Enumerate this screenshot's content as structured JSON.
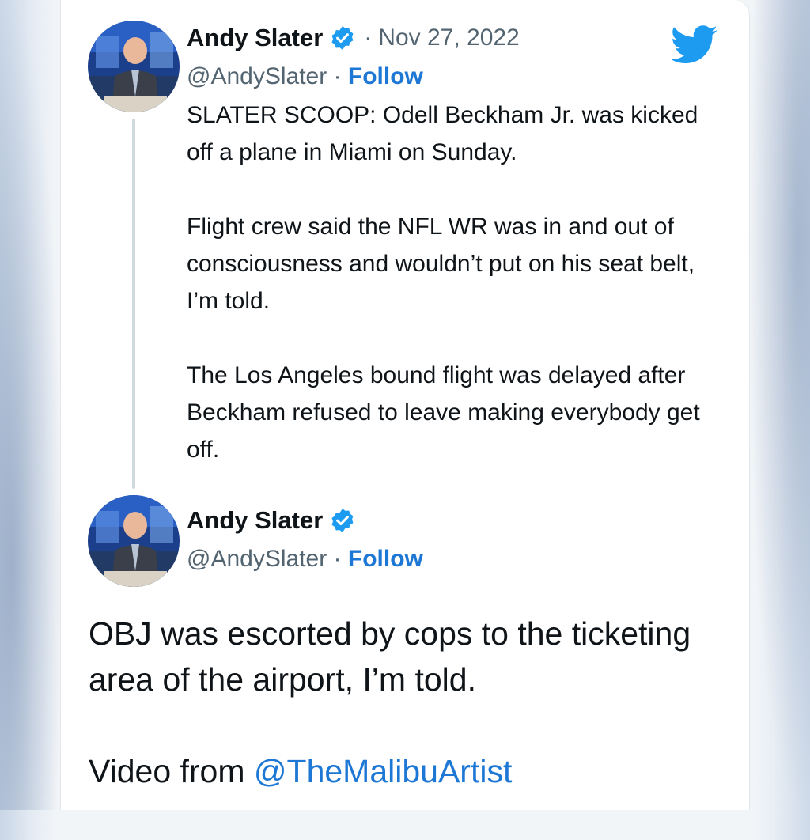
{
  "colors": {
    "accent": "#1d9bf0",
    "follow": "#1d77d4",
    "text": "#0f1419",
    "muted": "#536471"
  },
  "icons": {
    "logo": "twitter-bird-icon",
    "verified": "verified-badge-icon"
  },
  "tweet1": {
    "author": "Andy Slater",
    "separator": "·",
    "date": "Nov 27, 2022",
    "handle": "@AndySlater",
    "handle_sep": "·",
    "follow": "Follow",
    "paragraphs": [
      "SLATER SCOOP: Odell Beckham Jr. was kicked off a plane in Miami on Sunday.",
      "Flight crew said the NFL WR was in and out of consciousness and wouldn’t put on his seat belt, I’m told.",
      "The Los Angeles bound flight was delayed after Beckham refused to leave making everybody get off."
    ]
  },
  "tweet2": {
    "author": "Andy Slater",
    "handle": "@AndySlater",
    "handle_sep": "·",
    "follow": "Follow",
    "paragraph1": "OBJ was escorted by cops to the ticketing area of the airport, I’m told.",
    "paragraph2_prefix": "Video from ",
    "paragraph2_mention": "@TheMalibuArtist"
  }
}
